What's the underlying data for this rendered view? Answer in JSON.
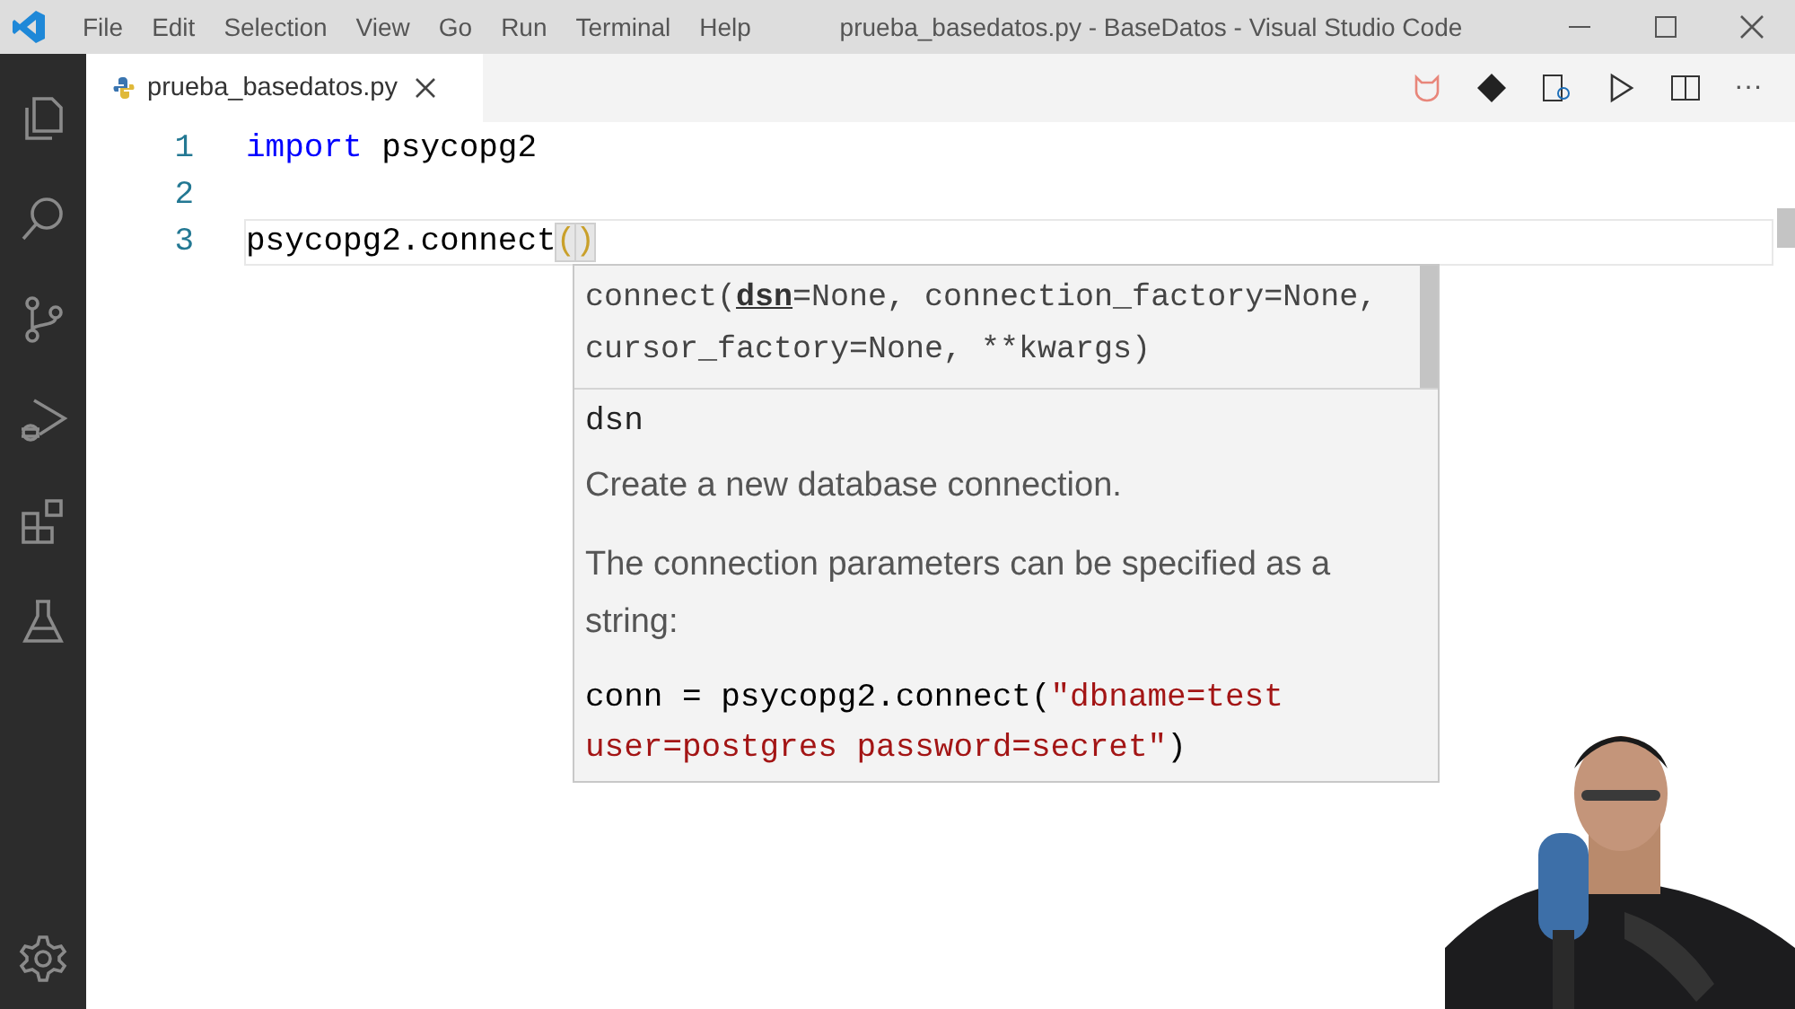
{
  "window": {
    "title": "prueba_basedatos.py - BaseDatos - Visual Studio Code"
  },
  "menu": [
    "File",
    "Edit",
    "Selection",
    "View",
    "Go",
    "Run",
    "Terminal",
    "Help"
  ],
  "tabs": [
    {
      "label": "prueba_basedatos.py",
      "selected": true
    }
  ],
  "editor_actions": {
    "more": "···"
  },
  "editor": {
    "lines": [
      {
        "number": "1",
        "current": false,
        "tokens": [
          {
            "kind": "keyword",
            "text": "import"
          },
          {
            "kind": "plain",
            "text": " psycopg2"
          }
        ]
      },
      {
        "number": "2",
        "current": false
      },
      {
        "number": "3",
        "current": true,
        "tokens": [
          {
            "kind": "plain",
            "text": "psycopg2.connect"
          },
          {
            "kind": "bracket",
            "text": "("
          },
          {
            "kind": "bracket",
            "text": ")"
          }
        ]
      }
    ]
  },
  "signature_help": {
    "signature": [
      {
        "kind": "plain",
        "text": "connect("
      },
      {
        "kind": "active",
        "text": "dsn"
      },
      {
        "kind": "plain",
        "text": "=None, connection_factory=None, cursor_factory=None, **kwargs)"
      }
    ],
    "parameter": "dsn",
    "paragraphs": [
      "Create a new database connection.",
      "The connection parameters can be specified as a string:"
    ],
    "code": [
      {
        "kind": "plain",
        "text": "conn = psycopg2.connect("
      },
      {
        "kind": "string",
        "text": "\"dbname=test user=postgres password=secret\""
      },
      {
        "kind": "plain",
        "text": ")"
      }
    ]
  }
}
